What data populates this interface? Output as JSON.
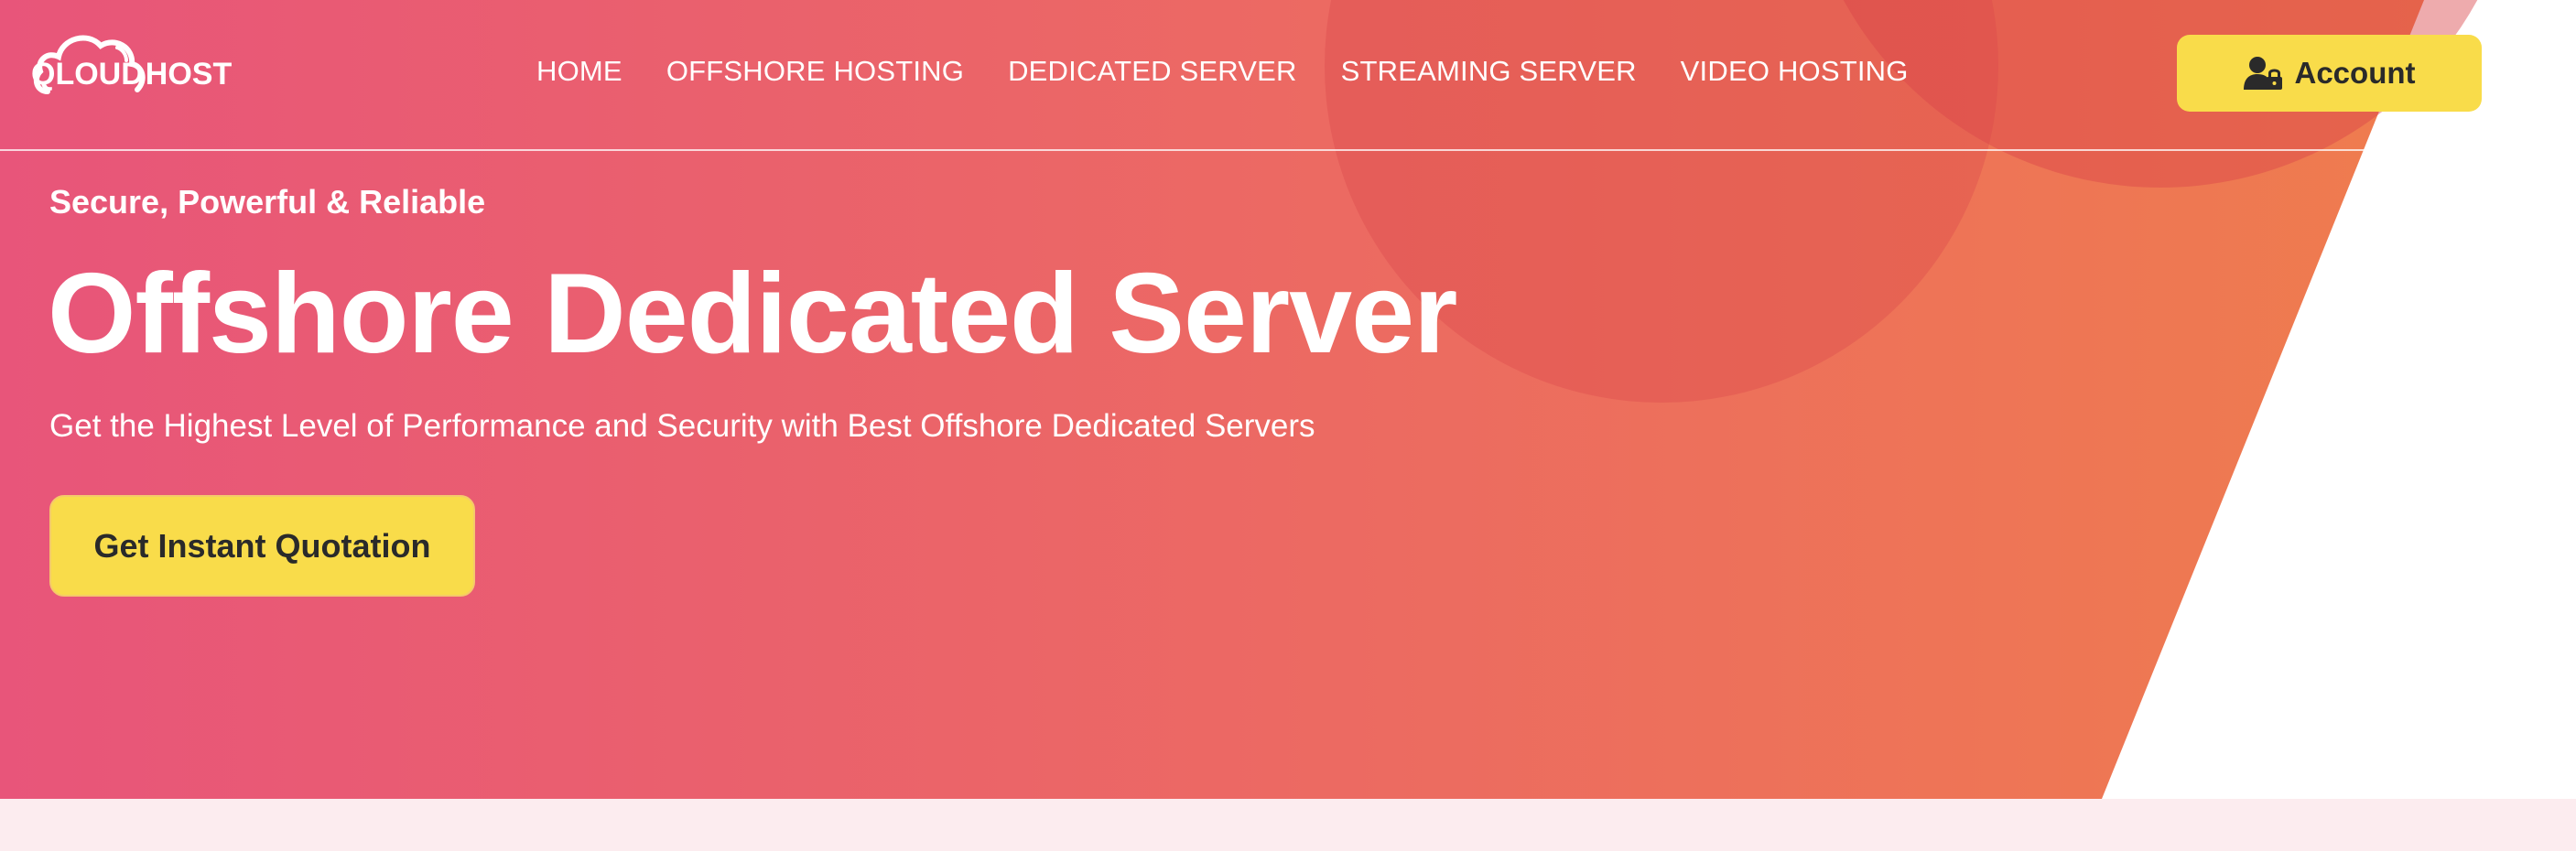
{
  "brand": {
    "logo_left": "QLOUD",
    "logo_right": "HOST"
  },
  "nav": {
    "items": [
      {
        "label": "HOME"
      },
      {
        "label": "OFFSHORE HOSTING"
      },
      {
        "label": "DEDICATED SERVER"
      },
      {
        "label": "STREAMING SERVER"
      },
      {
        "label": "VIDEO HOSTING"
      }
    ]
  },
  "account": {
    "label": "Account",
    "icon": "user-lock-icon"
  },
  "hero": {
    "tagline": "Secure, Powerful & Reliable",
    "title": "Offshore Dedicated Server",
    "subtitle": "Get the Highest Level of Performance and Security with Best Offshore Dedicated Servers",
    "cta_label": "Get Instant Quotation"
  },
  "colors": {
    "gradient_start": "#e8557a",
    "gradient_end": "#ef7a50",
    "button_yellow": "#f9dc4a",
    "button_text": "#2a2a2a",
    "bottom_band": "#fcecef"
  }
}
